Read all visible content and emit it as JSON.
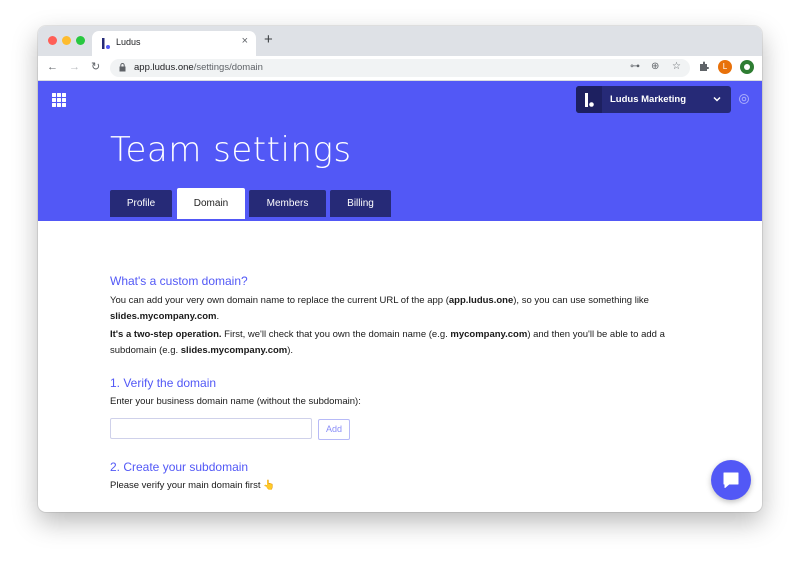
{
  "browser": {
    "tab_title": "Ludus",
    "url_host": "app.ludus.one",
    "url_path": "/settings/domain"
  },
  "header": {
    "team_name": "Ludus Marketing",
    "page_title": "Team settings",
    "tabs": [
      {
        "label": "Profile",
        "active": false
      },
      {
        "label": "Domain",
        "active": true
      },
      {
        "label": "Members",
        "active": false
      },
      {
        "label": "Billing",
        "active": false
      }
    ],
    "colors": {
      "accent": "#5258f6",
      "dark": "#262a77"
    }
  },
  "main": {
    "intro_heading": "What's a custom domain?",
    "intro_p1_a": "You can add your very own domain name to replace the current URL of the app (",
    "intro_p1_b": "app.ludus.one",
    "intro_p1_c": "), so you can use something like",
    "intro_p1_d": "slides.mycompany.com",
    "intro_p1_e": ".",
    "intro_p2_a": "It's a two-step operation.",
    "intro_p2_b": " First, we'll check that you own the domain name (e.g. ",
    "intro_p2_c": "mycompany.com",
    "intro_p2_d": ") and then you'll be able to add a",
    "intro_p2_e": "subdomain (e.g. ",
    "intro_p2_f": "slides.mycompany.com",
    "intro_p2_g": ").",
    "step1_heading": "1. Verify the domain",
    "step1_text": "Enter your business domain name (without the subdomain):",
    "domain_input_value": "",
    "add_label": "Add",
    "step2_heading": "2. Create your subdomain",
    "step2_text": "Please verify your main domain first",
    "step2_emoji": "👆"
  },
  "profile_avatar_letter": "L"
}
